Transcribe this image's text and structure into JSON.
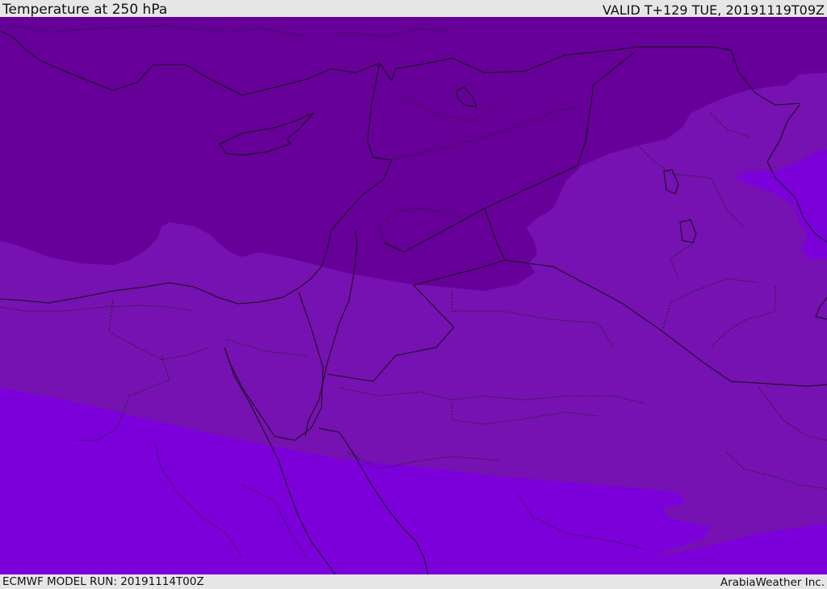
{
  "header": {
    "title": "Temperature at 250 hPa",
    "valid": "VALID T+129 TUE, 20191119T09Z"
  },
  "footer": {
    "model_run": "ECMWF MODEL RUN: 20191114T00Z",
    "credit": "ArabiaWeather Inc."
  },
  "map": {
    "colors": {
      "band_cold": "#660099",
      "band_mid": "#7611b2",
      "band_warm": "#7c00da",
      "border_line": "#111111",
      "header_bg": "#e6e6e6"
    }
  }
}
